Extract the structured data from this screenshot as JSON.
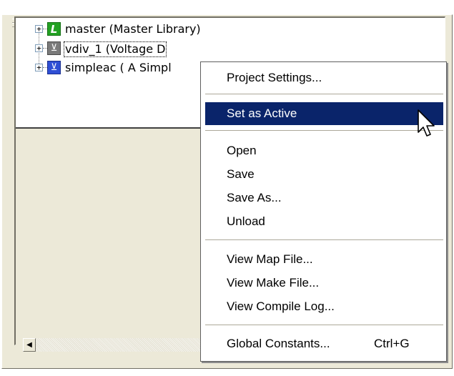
{
  "window": {
    "arrow_icon": "▲",
    "close_icon": "✕"
  },
  "tree": {
    "items": [
      {
        "expander": "+",
        "icon": "library-icon",
        "icon_glyph": "L",
        "label": "master (Master Library)"
      },
      {
        "expander": "+",
        "icon": "project-icon",
        "icon_glyph": "⊻",
        "label": "vdiv_1 (Voltage D"
      },
      {
        "expander": "+",
        "icon": "project-icon",
        "icon_glyph": "⊻",
        "label": "simpleac ( A Simpl"
      }
    ]
  },
  "scrollbar": {
    "left_arrow": "◀"
  },
  "context_menu": {
    "items": [
      {
        "label": "Project Settings...",
        "shortcut": ""
      },
      {
        "label": "Set as Active",
        "shortcut": "",
        "active": true
      },
      {
        "label": "Open",
        "shortcut": ""
      },
      {
        "label": "Save",
        "shortcut": ""
      },
      {
        "label": "Save As...",
        "shortcut": ""
      },
      {
        "label": "Unload",
        "shortcut": ""
      },
      {
        "label": "View Map File...",
        "shortcut": ""
      },
      {
        "label": "View Make File...",
        "shortcut": ""
      },
      {
        "label": "View Compile Log...",
        "shortcut": ""
      },
      {
        "label": "Global Constants...",
        "shortcut": "Ctrl+G"
      }
    ]
  },
  "colors": {
    "highlight": "#0a246a",
    "library_icon": "#23a123",
    "project_icon_gray": "#7a7a7a",
    "project_icon_blue": "#2f4fd4"
  }
}
